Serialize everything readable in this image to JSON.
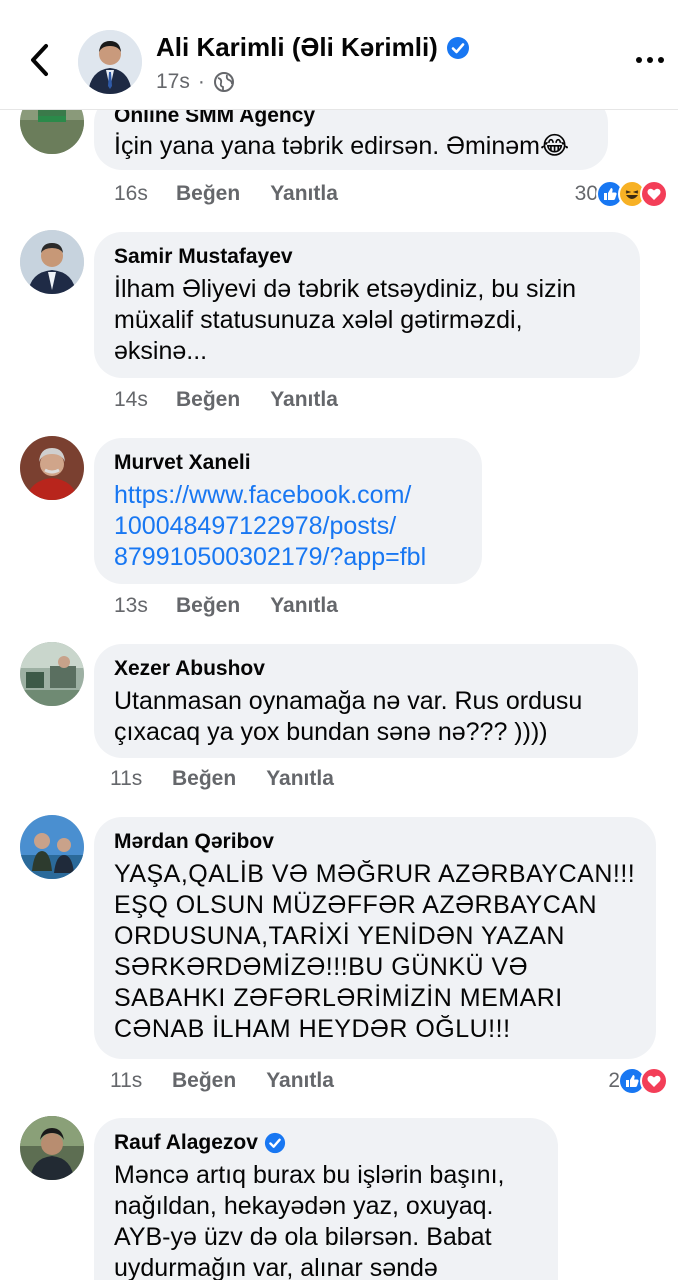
{
  "header": {
    "author": "Ali Karimli (Əli Kərimli)",
    "time": "17s",
    "dot": "·"
  },
  "comments": [
    {
      "name": "Online SMM Agency",
      "text": "İçin yana yana təbrik edirsən. Əminəm😂",
      "time": "16s",
      "like": "Beğen",
      "reply": "Yanıtla",
      "reaction_count": "30",
      "reactions": [
        "like",
        "haha",
        "love"
      ]
    },
    {
      "name": "Samir Mustafayev",
      "text": "İlham Əliyevi də təbrik etsəydiniz, bu sizin\nmüxalif statusunuza xələl gətirməzdi,\nəksinə...",
      "time": "14s",
      "like": "Beğen",
      "reply": "Yanıtla"
    },
    {
      "name": "Murvet Xaneli",
      "text": "https://www.facebook.com/\n100048497122978/posts/\n879910500302179/?app=fbl",
      "time": "13s",
      "like": "Beğen",
      "reply": "Yanıtla"
    },
    {
      "name": "Xezer Abushov",
      "text": "Utanmasan oynamağa nə var. Rus ordusu\nçıxacaq ya yox bundan sənə nə??? ))))",
      "time": "11s",
      "like": "Beğen",
      "reply": "Yanıtla"
    },
    {
      "name": "Mərdan Qəribov",
      "text": "YAŞA,QALİB VƏ MƏĞRUR AZƏRBAYCAN!!!\nEŞQ OLSUN MÜZƏFFƏR AZƏRBAYCAN\nORDUSUNA,TARİXİ YENİDƏN YAZAN\nSƏRKƏRDƏMİZƏ!!!BU GÜNKÜ VƏ\nSABAHKI ZƏFƏRLƏRİMİZİN MEMARI\nCƏNAB İLHAM HEYDƏR OĞLU!!!",
      "time": "11s",
      "like": "Beğen",
      "reply": "Yanıtla",
      "reaction_count": "2",
      "reactions": [
        "like",
        "love"
      ]
    },
    {
      "name": "Rauf Alagezov",
      "text": "Məncə artıq burax bu işlərin başını,\nnağıldan, hekayədən yaz, oxuyaq.\nAYB-yə üzv də ola bilərsən. Babat\nuydurmağın var, alınar səndə",
      "verified": true
    }
  ],
  "colors": {
    "accent": "#1877f2",
    "bubble": "#f0f2f5",
    "meta": "#65676b",
    "love": "#f33e58",
    "haha": "#f7b125"
  }
}
